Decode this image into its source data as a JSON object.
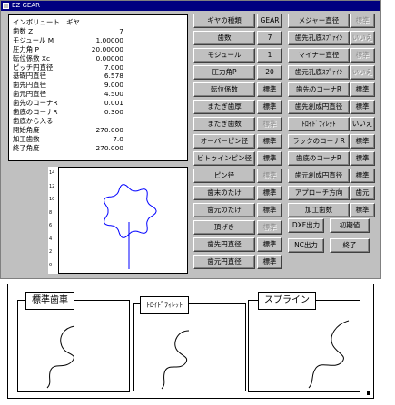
{
  "window": {
    "title": "EZ GEAR"
  },
  "info": {
    "rows": [
      {
        "label": "インボリュート　ギヤ",
        "value": ""
      },
      {
        "label": "歯数 Z",
        "value": "7"
      },
      {
        "label": "モジュール M",
        "value": "1.00000"
      },
      {
        "label": "圧力角 P",
        "value": "20.00000"
      },
      {
        "label": "転位係数 Xc",
        "value": "0.00000"
      },
      {
        "label": "ピッチ円直径",
        "value": "7.000"
      },
      {
        "label": "基礎円直径",
        "value": "6.578"
      },
      {
        "label": "歯先円直径",
        "value": "9.000"
      },
      {
        "label": "歯元円直径",
        "value": "4.500"
      },
      {
        "label": "歯先のコーナR",
        "value": "0.001"
      },
      {
        "label": "歯底のコーナR",
        "value": "0.300"
      },
      {
        "label": "歯底から入る",
        "value": ""
      },
      {
        "label": "開始角度",
        "value": "270.000"
      },
      {
        "label": "加工歯数",
        "value": "7.0"
      },
      {
        "label": "終了角度",
        "value": "270.000"
      }
    ]
  },
  "ruler": {
    "ticks": [
      "14",
      "12",
      "10",
      "8",
      "6",
      "4",
      "2",
      "0"
    ]
  },
  "buttons": {
    "col1": [
      {
        "label": "ギヤの種類",
        "value": "GEAR",
        "gray": false
      },
      {
        "label": "歯数",
        "value": "7",
        "gray": false
      },
      {
        "label": "モジュール",
        "value": "1",
        "gray": false
      },
      {
        "label": "圧力角P",
        "value": "20",
        "gray": false
      },
      {
        "label": "転位係数",
        "value": "標準",
        "gray": false
      },
      {
        "label": "またぎ歯厚",
        "value": "標準",
        "gray": false
      },
      {
        "label": "またぎ歯数",
        "value": "標準",
        "gray": true
      },
      {
        "label": "オーバーピン径",
        "value": "標準",
        "gray": false
      },
      {
        "label": "ビトゥインピン径",
        "value": "標準",
        "gray": false
      },
      {
        "label": "ピン径",
        "value": "標準",
        "gray": true
      },
      {
        "label": "歯末のたけ",
        "value": "標準",
        "gray": false
      },
      {
        "label": "歯元のたけ",
        "value": "標準",
        "gray": false
      },
      {
        "label": "頂げき",
        "value": "標準",
        "gray": true
      },
      {
        "label": "歯先円直径",
        "value": "標準",
        "gray": false
      },
      {
        "label": "歯元円直径",
        "value": "標準",
        "gray": false
      }
    ],
    "col2": [
      {
        "label": "メジャー直径",
        "value": "標準",
        "gray": true
      },
      {
        "label": "歯先孔底ｽﾌﾟｧｲﾝ",
        "value": "いいえ",
        "gray": true
      },
      {
        "label": "マイナー直径",
        "value": "標準",
        "gray": true
      },
      {
        "label": "歯元孔底ｽﾌﾟｧｲﾝ",
        "value": "いいえ",
        "gray": true
      },
      {
        "label": "歯先のコーナR",
        "value": "標準",
        "gray": false
      },
      {
        "label": "歯先創成円直径",
        "value": "標準",
        "gray": false
      },
      {
        "label": "ﾄﾛｲﾄﾞﾌｨﾚｯﾄ",
        "value": "いいえ",
        "gray": false
      },
      {
        "label": "ラックのコーナR",
        "value": "標準",
        "gray": false
      },
      {
        "label": "歯底のコーナR",
        "value": "標準",
        "gray": false
      },
      {
        "label": "歯元創成円直径",
        "value": "標準",
        "gray": false
      },
      {
        "label": "アプローチ方向",
        "value": "歯元",
        "gray": false
      },
      {
        "label": "加工歯数",
        "value": "標準",
        "gray": false
      }
    ],
    "dxf": "DXF出力",
    "init": "初期値",
    "nc": "NC出力",
    "exit": "終了"
  },
  "cards": {
    "standard": "標準歯車",
    "trochoid": "ﾄﾛｲﾄﾞﾌｨﾚｯﾄ",
    "spline": "スプライン"
  }
}
